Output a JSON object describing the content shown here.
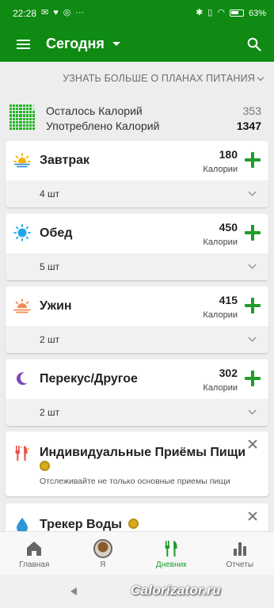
{
  "status_bar": {
    "time": "22:28",
    "battery": "63"
  },
  "app_bar": {
    "title": "Сегодня"
  },
  "learn_more": "УЗНАТЬ БОЛЬШЕ О ПЛАНАХ ПИТАНИЯ",
  "summary": {
    "remaining_label": "Осталось Калорий",
    "remaining_value": "353",
    "consumed_label": "Употреблено Калорий",
    "consumed_value": "1347"
  },
  "meals": [
    {
      "name": "Завтрак",
      "calories": "180",
      "unit": "Калории",
      "count": "4 шт",
      "icon": "sunrise-icon"
    },
    {
      "name": "Обед",
      "calories": "450",
      "unit": "Калории",
      "count": "5 шт",
      "icon": "sun-icon"
    },
    {
      "name": "Ужин",
      "calories": "415",
      "unit": "Калории",
      "count": "2 шт",
      "icon": "sunset-icon"
    },
    {
      "name": "Перекус/Другое",
      "calories": "302",
      "unit": "Калории",
      "count": "2 шт",
      "icon": "moon-icon"
    }
  ],
  "promos": [
    {
      "title": "Индивидуальные Приёмы Пищи",
      "desc": "Отслеживайте не только основные приемы пищи",
      "icon": "cutlery-icon"
    },
    {
      "title": "Трекер Воды",
      "icon": "water-drop-icon"
    }
  ],
  "bottom_nav": [
    {
      "label": "Главная",
      "icon": "home-icon"
    },
    {
      "label": "Я",
      "icon": "avatar-icon"
    },
    {
      "label": "Дневник",
      "icon": "fork-knife-icon"
    },
    {
      "label": "Отчеты",
      "icon": "bar-chart-icon"
    }
  ],
  "watermark": "Calorizator.ru",
  "colors": {
    "brand_green": "#0f8a12",
    "accent_green": "#1f9d2a"
  }
}
